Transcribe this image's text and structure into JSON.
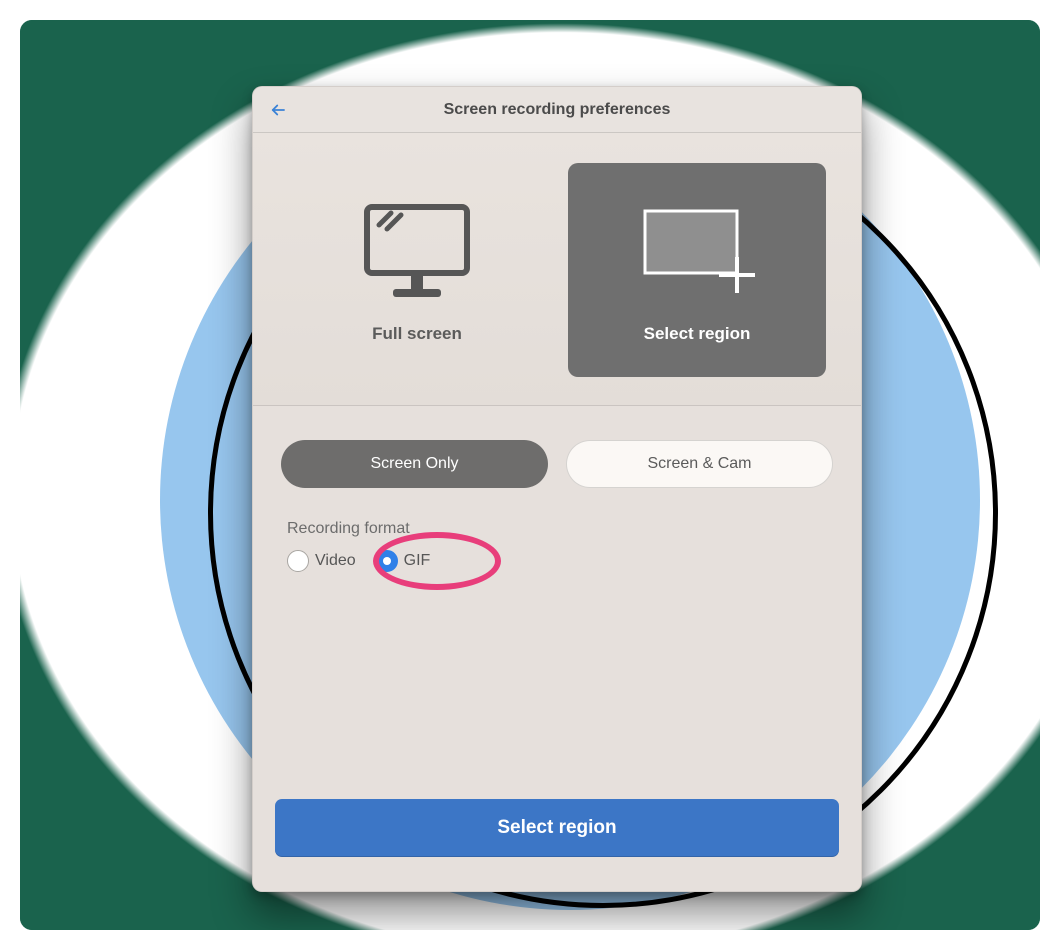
{
  "header": {
    "title": "Screen recording preferences"
  },
  "modes": {
    "full_screen": {
      "label": "Full screen",
      "selected": false
    },
    "select_region": {
      "label": "Select region",
      "selected": true
    }
  },
  "source_toggle": {
    "screen_only": "Screen Only",
    "screen_cam": "Screen & Cam",
    "active": "screen_only"
  },
  "format": {
    "section_label": "Recording format",
    "options": {
      "video": {
        "label": "Video",
        "selected": false
      },
      "gif": {
        "label": "GIF",
        "selected": true
      }
    }
  },
  "footer": {
    "primary_label": "Select region"
  },
  "annotation": {
    "highlight_target": "format.options.gif",
    "color": "#e83e7b"
  }
}
